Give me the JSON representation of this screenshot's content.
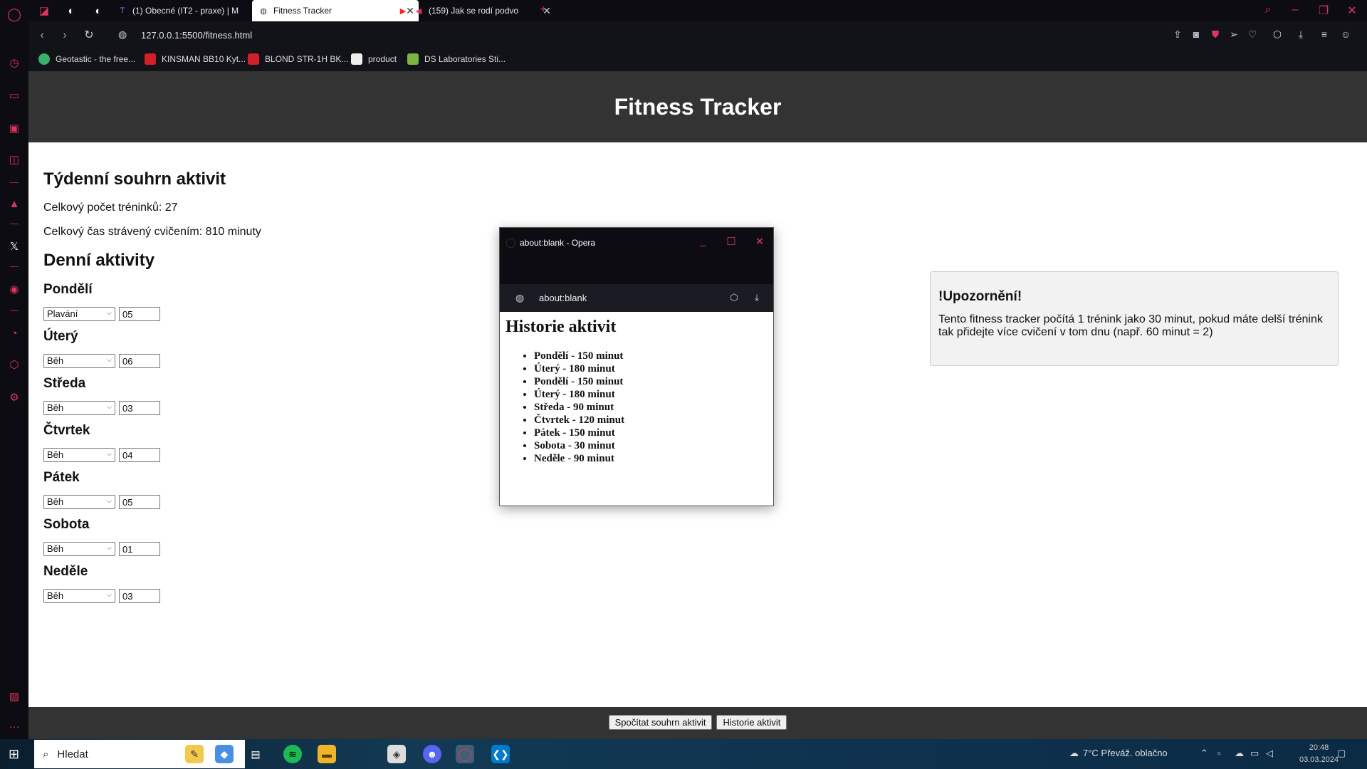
{
  "browser": {
    "tabs": [
      {
        "title": "(1) Obecné (IT2 - praxe) | M",
        "icon": "teams-icon",
        "active": false
      },
      {
        "title": "Fitness Tracker",
        "icon": "globe-icon",
        "active": true
      },
      {
        "title": "(159) Jak se rodí podvo",
        "icon": "youtube-icon",
        "active": false
      }
    ],
    "new_tab": "+",
    "url": "127.0.0.1:5500/fitness.html",
    "bookmarks": [
      {
        "label": "Geotastic - the free...",
        "color": "#3bb06a"
      },
      {
        "label": "KINSMAN BB10 Kyt...",
        "color": "#d0202a"
      },
      {
        "label": "BLOND STR-1H BK...",
        "color": "#d0202a"
      },
      {
        "label": "product",
        "color": "#eeeeee"
      },
      {
        "label": "DS Laboratories Sti...",
        "color": "#7cb342"
      }
    ],
    "accent": "#e0315f"
  },
  "page": {
    "title": "Fitness Tracker",
    "summary": {
      "heading": "Týdenní souhrn aktivit",
      "total_workouts": "Celkový počet tréninků: 27",
      "total_time": "Celkový čas strávený cvičením: 810 minuty"
    },
    "daily_heading": "Denní aktivity",
    "days": [
      {
        "name": "Pondělí",
        "activity": "Plavání",
        "count": "05"
      },
      {
        "name": "Úterý",
        "activity": "Běh",
        "count": "06"
      },
      {
        "name": "Středa",
        "activity": "Běh",
        "count": "03"
      },
      {
        "name": "Čtvrtek",
        "activity": "Běh",
        "count": "04"
      },
      {
        "name": "Pátek",
        "activity": "Běh",
        "count": "05"
      },
      {
        "name": "Sobota",
        "activity": "Běh",
        "count": "01"
      },
      {
        "name": "Neděle",
        "activity": "Běh",
        "count": "03"
      }
    ],
    "warning": {
      "title": "!Upozornění!",
      "text": "Tento fitness tracker počítá 1 trénink jako 30 minut, pokud máte delší trénink tak přidejte více cvičení v tom dnu (např. 60 minut = 2)"
    },
    "buttons": {
      "summary": "Spočítat souhrn aktivit",
      "history": "Historie aktivit"
    }
  },
  "popup": {
    "window_title": "about:blank - Opera",
    "url": "about:blank",
    "heading": "Historie aktivit",
    "items": [
      "Pondělí - 150 minut",
      "Úterý - 180 minut",
      "Pondělí - 150 minut",
      "Úterý - 180 minut",
      "Středa - 90 minut",
      "Čtvrtek - 120 minut",
      "Pátek - 150 minut",
      "Sobota - 30 minut",
      "Neděle - 90 minut"
    ]
  },
  "taskbar": {
    "search_placeholder": "Hledat",
    "weather": "7°C  Převáž. oblačno",
    "time": "20:48",
    "date": "03.03.2024"
  }
}
